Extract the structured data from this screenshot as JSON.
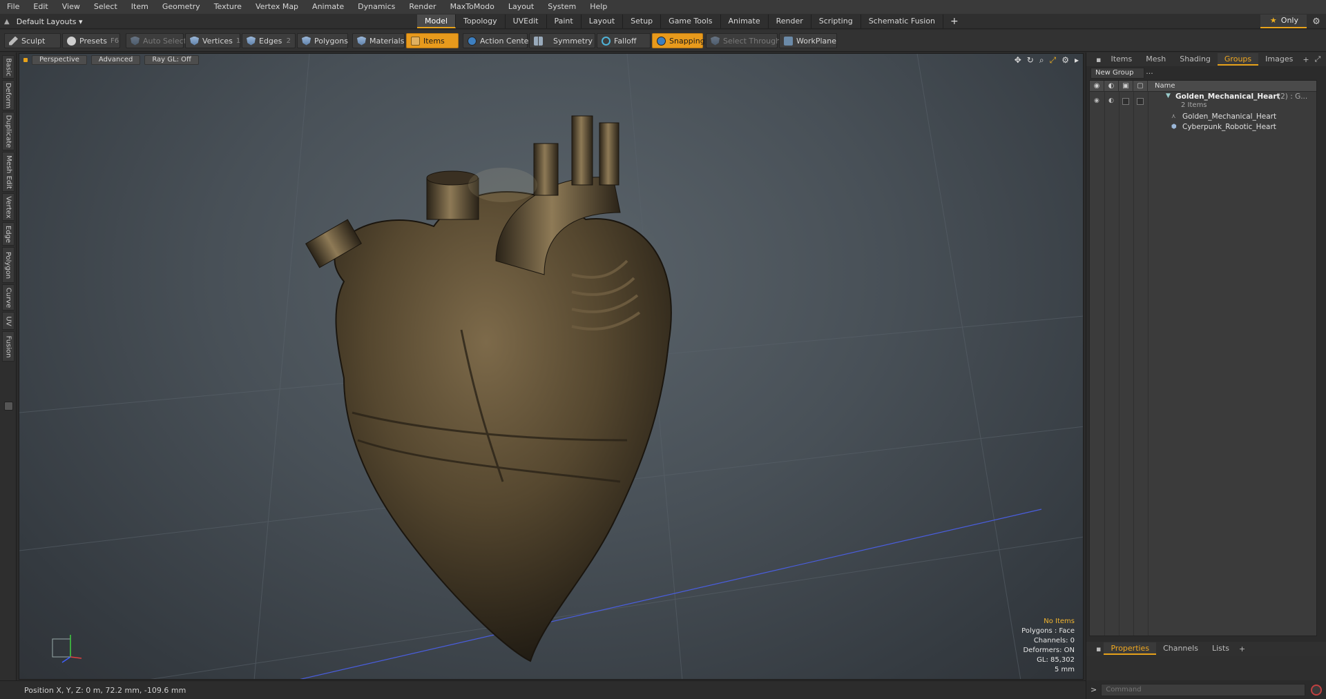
{
  "menu": [
    "File",
    "Edit",
    "View",
    "Select",
    "Item",
    "Geometry",
    "Texture",
    "Vertex Map",
    "Animate",
    "Dynamics",
    "Render",
    "MaxToModo",
    "Layout",
    "System",
    "Help"
  ],
  "layoutbar": {
    "dropdown": "Default Layouts ▾",
    "tabs": [
      "Model",
      "Topology",
      "UVEdit",
      "Paint",
      "Layout",
      "Setup",
      "Game Tools",
      "Animate",
      "Render",
      "Scripting",
      "Schematic Fusion"
    ],
    "active_tab": "Model",
    "only": "Only"
  },
  "toolbar": {
    "sculpt": "Sculpt",
    "presets": "Presets",
    "presets_key": "F6",
    "auto_select": "Auto Select",
    "vertices": "Vertices",
    "vertices_key": "1",
    "edges": "Edges",
    "edges_key": "2",
    "polygons": "Polygons",
    "materials": "Materials",
    "items": "Items",
    "action_center": "Action Center",
    "symmetry": "Symmetry",
    "falloff": "Falloff",
    "snapping": "Snapping",
    "select_through": "Select Through",
    "workplane": "WorkPlane"
  },
  "lefttabs": [
    "Basic",
    "Deform",
    "Duplicate",
    "Mesh Edit",
    "Vertex",
    "Edge",
    "Polygon",
    "Curve",
    "UV",
    "Fusion"
  ],
  "viewport": {
    "perspective": "Perspective",
    "advanced": "Advanced",
    "raygl": "Ray GL: Off",
    "hud": {
      "no_items": "No Items",
      "polygons": "Polygons : Face",
      "channels": "Channels: 0",
      "deformers": "Deformers: ON",
      "gl": "GL: 85,302",
      "scale": "5 mm"
    }
  },
  "status": "Position X, Y, Z:   0 m, 72.2 mm, -109.6 mm",
  "rightpanel": {
    "tabs": [
      "Items",
      "Mesh ...",
      "Shading",
      "Groups",
      "Images"
    ],
    "active_tab": "Groups",
    "new_group": "New Group",
    "col_name": "Name",
    "group_name": "Golden_Mechanical_Heart",
    "group_suffix": "(2) : G...",
    "group_count": "2 Items",
    "children": [
      "Golden_Mechanical_Heart",
      "Cyberpunk_Robotic_Heart"
    ],
    "bottom_tabs": [
      "Properties",
      "Channels",
      "Lists"
    ],
    "active_bottom": "Properties",
    "command_placeholder": "Command"
  },
  "colors": {
    "accent": "#e8a21a",
    "heart": "#5a4c36"
  }
}
